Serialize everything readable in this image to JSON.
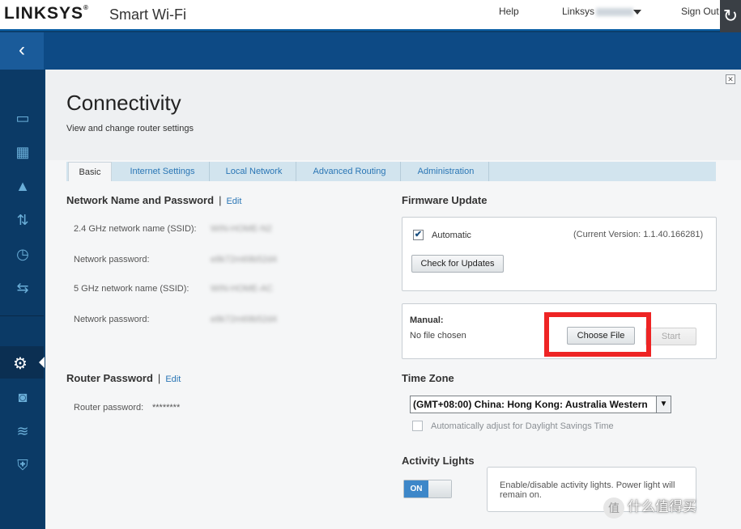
{
  "header": {
    "logo": "LINKSYS",
    "app_name": "Smart Wi-Fi",
    "help": "Help",
    "user": "Linksys",
    "sign_out": "Sign Out"
  },
  "sidebar": {
    "icons": [
      "devices-icon",
      "network-map-icon",
      "alert-icon",
      "priority-icon",
      "speed-icon",
      "ethernet-icon",
      "settings-icon",
      "camera-icon",
      "wifi-settings-icon",
      "security-icon"
    ],
    "active": "settings-icon"
  },
  "page": {
    "title": "Connectivity",
    "subtitle": "View and change router settings"
  },
  "tabs": [
    {
      "label": "Basic",
      "active": true
    },
    {
      "label": "Internet Settings",
      "active": false
    },
    {
      "label": "Local Network",
      "active": false
    },
    {
      "label": "Advanced Routing",
      "active": false
    },
    {
      "label": "Administration",
      "active": false
    }
  ],
  "network": {
    "heading": "Network Name and Password",
    "separator": "|",
    "edit": "Edit",
    "fields": [
      {
        "label": "2.4 GHz network name (SSID):",
        "value": "WIN-HOME-N2"
      },
      {
        "label": "Network password:",
        "value": "e8k72m69b52d4"
      },
      {
        "label": "5 GHz network name (SSID):",
        "value": "WIN-HOME-AC"
      },
      {
        "label": "Network password:",
        "value": "e8k72m69b52d4"
      }
    ]
  },
  "router_password": {
    "heading": "Router Password",
    "separator": "|",
    "edit": "Edit",
    "label": "Router password:",
    "value": "********"
  },
  "firmware": {
    "heading": "Firmware Update",
    "automatic_label": "Automatic",
    "automatic_checked": true,
    "current_version": "(Current Version: 1.1.40.166281)",
    "check_button": "Check for Updates",
    "manual_label": "Manual:",
    "file_status": "No file chosen",
    "choose_button": "Choose File",
    "start_button": "Start"
  },
  "timezone": {
    "heading": "Time Zone",
    "selected": "(GMT+08:00) China: Hong Kong: Australia Western",
    "dst_label": "Automatically adjust for Daylight Savings Time",
    "dst_checked": false
  },
  "activity": {
    "heading": "Activity Lights",
    "toggle": "ON",
    "tip": "Enable/disable activity lights. Power light will remain on."
  },
  "watermark": {
    "badge": "值",
    "text": "什么值得买"
  },
  "colors": {
    "accent": "#2a76b5",
    "highlight_frame": "#ee2424",
    "sidebar": "#0b3a66"
  }
}
